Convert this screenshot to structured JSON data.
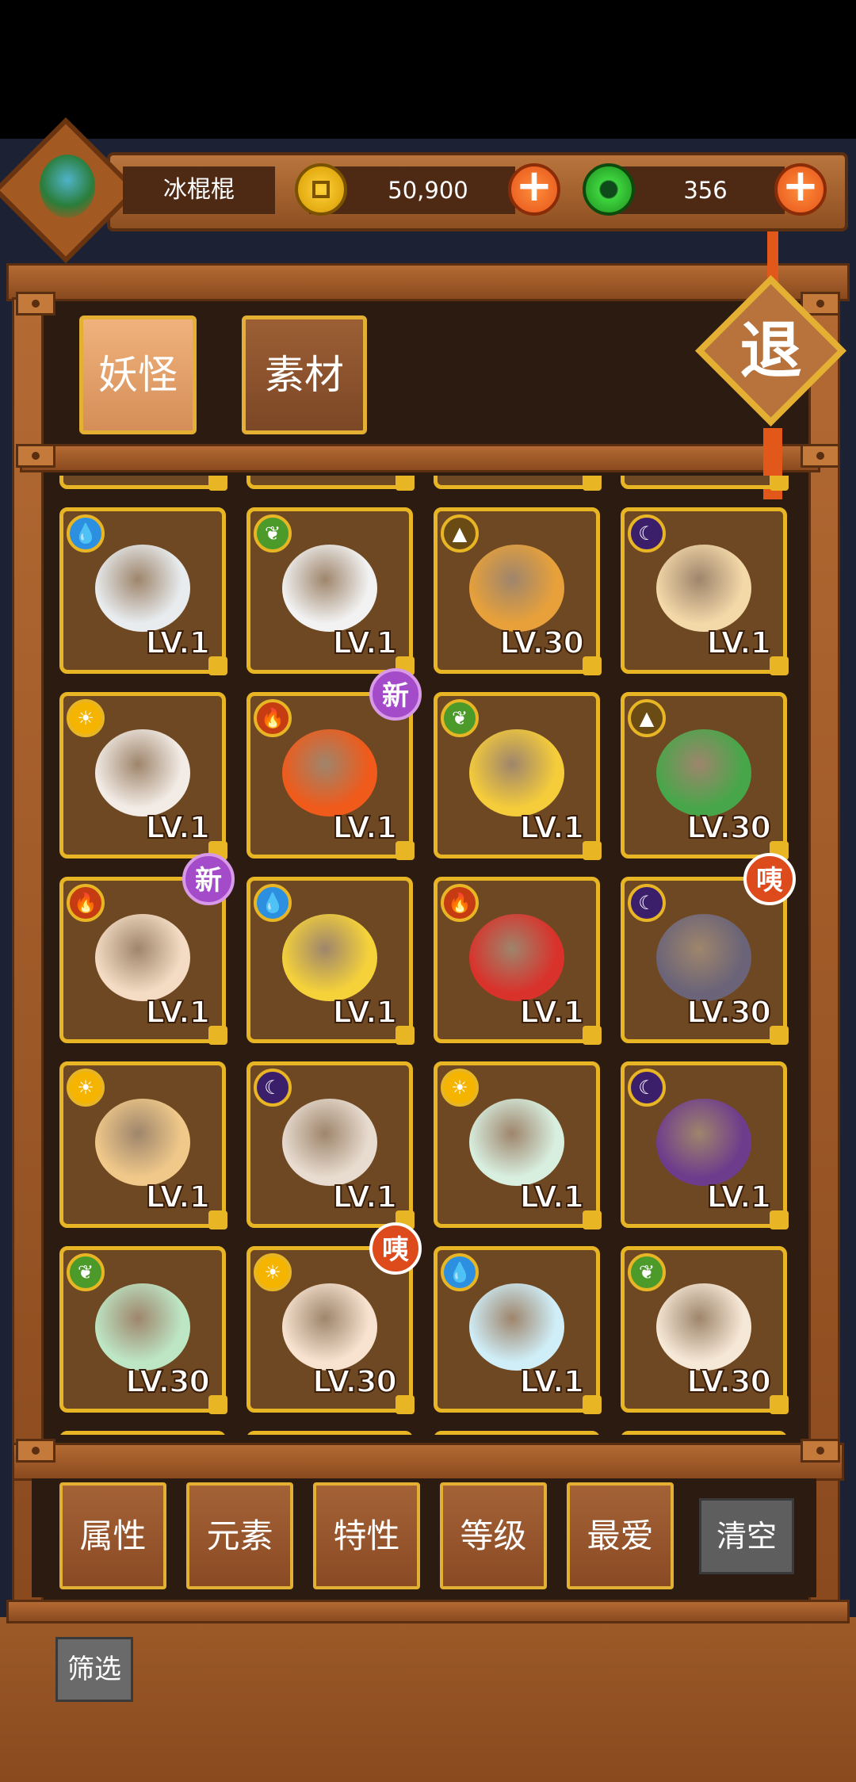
{
  "player": {
    "name": "冰棍棍"
  },
  "currency": {
    "coins": "50,900",
    "gems": "356",
    "coin_color": "#e7b400",
    "gem_color": "#2fb52f"
  },
  "tabs": [
    {
      "label": "妖怪",
      "selected": true
    },
    {
      "label": "素材",
      "selected": false
    }
  ],
  "exit_label": "退",
  "elements": {
    "water": {
      "color": "#2d8fe0",
      "icon": "water-drop-icon",
      "glyph": "💧"
    },
    "leaf": {
      "color": "#4c9a2a",
      "icon": "leaf-icon",
      "glyph": "❦"
    },
    "earth": {
      "color": "#6b4b14",
      "icon": "mountain-icon",
      "glyph": "▲"
    },
    "dark": {
      "color": "#3b1f6b",
      "icon": "moon-icon",
      "glyph": "☾"
    },
    "light": {
      "color": "#f4b400",
      "icon": "sun-icon",
      "glyph": "☀"
    },
    "fire": {
      "color": "#c53b12",
      "icon": "fire-icon",
      "glyph": "🔥"
    }
  },
  "monsters": [
    {
      "element": "water",
      "level": "LV.1",
      "art_color": "#e8ecef",
      "art": "white-deer-monster"
    },
    {
      "element": "leaf",
      "level": "LV.1",
      "art_color": "#f2f2f2",
      "art": "cat-on-leaf-monster"
    },
    {
      "element": "earth",
      "level": "LV.30",
      "art_color": "#e8a13a",
      "art": "ginkgo-branch-monster"
    },
    {
      "element": "dark",
      "level": "LV.1",
      "art_color": "#f3d8a8",
      "art": "scholar-monster"
    },
    {
      "element": "light",
      "level": "LV.1",
      "art_color": "#f3ece6",
      "art": "mouse-in-box-monster"
    },
    {
      "element": "fire",
      "level": "LV.1",
      "art_color": "#f05a1a",
      "art": "flame-monster",
      "badge": "新",
      "badge_type": "new"
    },
    {
      "element": "leaf",
      "level": "LV.1",
      "art_color": "#f5cc3a",
      "art": "corn-monster"
    },
    {
      "element": "earth",
      "level": "LV.30",
      "art_color": "#48a64a",
      "art": "watermelon-monster"
    },
    {
      "element": "fire",
      "level": "LV.1",
      "art_color": "#f4dcc4",
      "art": "egg-bat-monster",
      "badge": "新",
      "badge_type": "new"
    },
    {
      "element": "water",
      "level": "LV.1",
      "art_color": "#f5d23a",
      "art": "chick-cannon-monster"
    },
    {
      "element": "fire",
      "level": "LV.1",
      "art_color": "#d9322b",
      "art": "yarn-ball-monster"
    },
    {
      "element": "dark",
      "level": "LV.30",
      "art_color": "#6b6478",
      "art": "chess-piece-monster",
      "badge": "咦",
      "badge_type": "alert"
    },
    {
      "element": "light",
      "level": "LV.1",
      "art_color": "#f0c98a",
      "art": "xiangqi-piece-monster"
    },
    {
      "element": "dark",
      "level": "LV.1",
      "art_color": "#e8dcd0",
      "art": "bat-fan-monster"
    },
    {
      "element": "light",
      "level": "LV.1",
      "art_color": "#d8efe0",
      "art": "crate-monster"
    },
    {
      "element": "dark",
      "level": "LV.1",
      "art_color": "#6e3c8c",
      "art": "eggplant-monster"
    },
    {
      "element": "leaf",
      "level": "LV.30",
      "art_color": "#bde6c4",
      "art": "cabbage-spirit-monster"
    },
    {
      "element": "light",
      "level": "LV.30",
      "art_color": "#f7e3d0",
      "art": "bun-deer-monster",
      "badge": "咦",
      "badge_type": "alert"
    },
    {
      "element": "water",
      "level": "LV.1",
      "art_color": "#cfeef8",
      "art": "bubble-monster"
    },
    {
      "element": "leaf",
      "level": "LV.30",
      "art_color": "#f6e8d6",
      "art": "lily-spirit-monster"
    }
  ],
  "filters": [
    {
      "label": "属性"
    },
    {
      "label": "元素"
    },
    {
      "label": "特性"
    },
    {
      "label": "等级"
    },
    {
      "label": "最爱"
    }
  ],
  "clear_label": "清空",
  "filter_label": "筛选"
}
